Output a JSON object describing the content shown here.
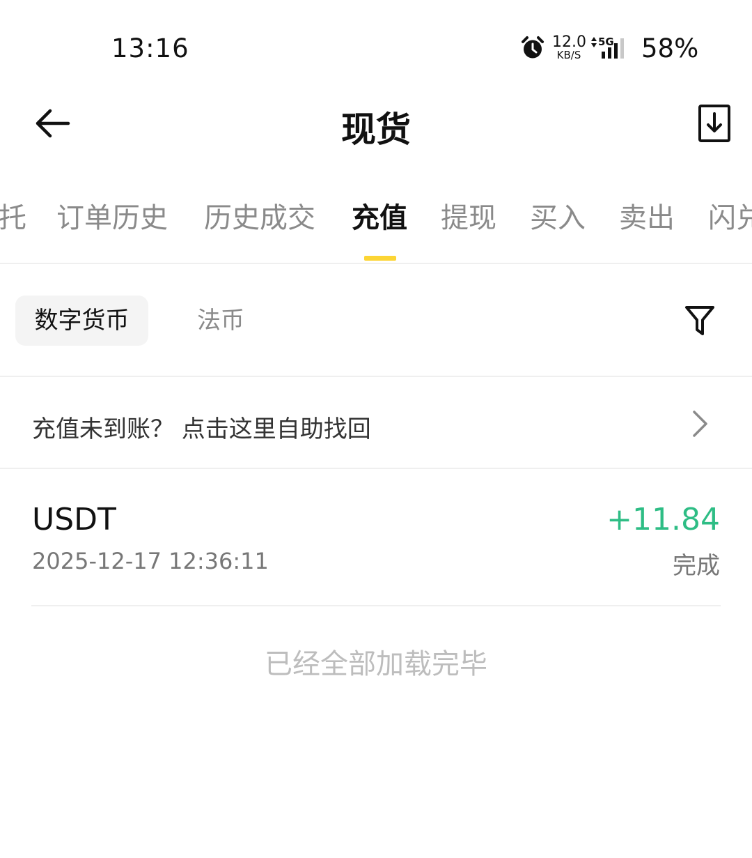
{
  "status_bar": {
    "time": "13:16",
    "net_speed_value": "12.0",
    "net_speed_unit": "KB/S",
    "network_type": "5G",
    "battery": "58%",
    "icons": [
      "alarm-icon",
      "signal-icon"
    ]
  },
  "header": {
    "title": "现货",
    "icons": [
      "back-arrow-icon",
      "download-icon"
    ]
  },
  "tabs": [
    {
      "label": "托",
      "active": false
    },
    {
      "label": "订单历史",
      "active": false
    },
    {
      "label": "历史成交",
      "active": false
    },
    {
      "label": "充值",
      "active": true
    },
    {
      "label": "提现",
      "active": false
    },
    {
      "label": "买入",
      "active": false
    },
    {
      "label": "卖出",
      "active": false
    },
    {
      "label": "闪兑",
      "active": false
    }
  ],
  "filters": {
    "options": [
      "数字货币",
      "法币"
    ],
    "selected": "数字货币",
    "icon": "filter-icon"
  },
  "help_link": {
    "text": "充值未到账？ 点击这里自助找回",
    "icon": "chevron-right-icon"
  },
  "records": [
    {
      "asset": "USDT",
      "datetime": "2025-12-17 12:36:11",
      "amount": "+11.84",
      "status": "完成"
    }
  ],
  "end_note": "已经全部加载完毕",
  "colors": {
    "accent": "#fcd535",
    "positive": "#2ebd85",
    "muted_text": "#8a8a8a"
  }
}
